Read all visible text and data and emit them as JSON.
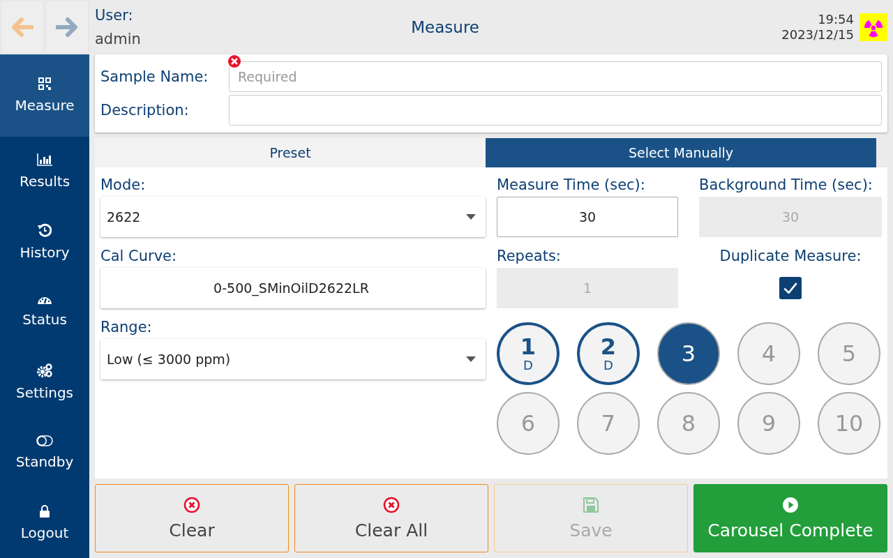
{
  "header": {
    "user_label": "User:",
    "user_name": "admin",
    "title": "Measure",
    "time": "19:54",
    "date": "2023/12/15"
  },
  "sidebar": {
    "items": [
      {
        "label": "Measure",
        "selected": true
      },
      {
        "label": "Results",
        "selected": false
      },
      {
        "label": "History",
        "selected": false
      },
      {
        "label": "Status",
        "selected": false
      },
      {
        "label": "Settings",
        "selected": false
      },
      {
        "label": "Standby",
        "selected": false
      },
      {
        "label": "Logout",
        "selected": false
      }
    ]
  },
  "sample_form": {
    "fields": [
      {
        "label": "Sample Name:",
        "placeholder": "Required",
        "error": true
      },
      {
        "label": "Description:",
        "error": false
      }
    ]
  },
  "tabs": [
    {
      "label": "Preset",
      "selected": false
    },
    {
      "label": "Select Manually",
      "selected": true
    }
  ],
  "left": {
    "items": [
      {
        "kind": "dropdown",
        "label": "Mode:",
        "value": "2622"
      },
      {
        "kind": "button",
        "label": "Cal Curve:",
        "value": "0-500_SMinOilD2622LR"
      },
      {
        "kind": "dropdown",
        "label": "Range:",
        "value": "Low (≤ 3000 ppm)"
      }
    ]
  },
  "settings": {
    "measure_time": {
      "label": "Measure Time (sec):",
      "value": "30",
      "disabled": false
    },
    "background_time": {
      "label": "Background Time (sec):",
      "value": "30",
      "disabled": true
    },
    "repeats": {
      "label": "Repeats:",
      "value": "1",
      "disabled": true
    },
    "duplicate": {
      "label": "Duplicate Measure:",
      "checked": true
    }
  },
  "carousel": {
    "positions": [
      {
        "number": "1",
        "sub": "D",
        "kind": "done"
      },
      {
        "number": "2",
        "sub": "D",
        "kind": "done"
      },
      {
        "number": "3",
        "kind": "current"
      },
      {
        "number": "4",
        "kind": "empty"
      },
      {
        "number": "5",
        "kind": "empty"
      },
      {
        "number": "6",
        "kind": "empty"
      },
      {
        "number": "7",
        "kind": "empty"
      },
      {
        "number": "8",
        "kind": "empty"
      },
      {
        "number": "9",
        "kind": "empty"
      },
      {
        "number": "10",
        "kind": "empty"
      }
    ]
  },
  "buttons": [
    {
      "label": "Clear",
      "kind": "clear",
      "disabled": false
    },
    {
      "label": "Clear All",
      "kind": "clear",
      "disabled": false
    },
    {
      "label": "Save",
      "kind": "save",
      "disabled": true
    },
    {
      "label": "Carousel Complete",
      "kind": "play",
      "disabled": false
    }
  ]
}
